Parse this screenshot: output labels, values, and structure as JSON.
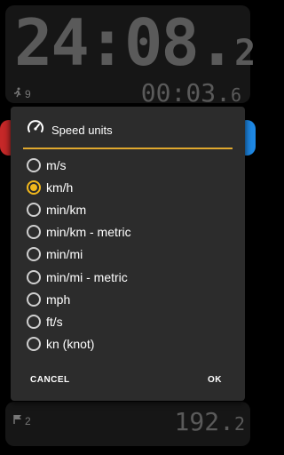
{
  "background": {
    "main_time": "24:08.",
    "main_time_frac": "2",
    "lap_time": "00:03.",
    "lap_time_frac": "6",
    "laps_count": "9",
    "flag_count": "2",
    "distance": "192.",
    "distance_frac": "2"
  },
  "dialog": {
    "title": "Speed units",
    "icon": "speedometer-icon",
    "options": [
      "m/s",
      "km/h",
      "min/km",
      "min/km - metric",
      "min/mi",
      "min/mi - metric",
      "mph",
      "ft/s",
      "kn (knot)"
    ],
    "selected": "km/h",
    "cancel_label": "CANCEL",
    "ok_label": "OK"
  },
  "colors": {
    "accent": "#f2b81c",
    "divider": "#e0a82e",
    "dialog_bg": "#2c2c2c",
    "left_button": "#c62828",
    "right_button": "#1e88e5"
  }
}
